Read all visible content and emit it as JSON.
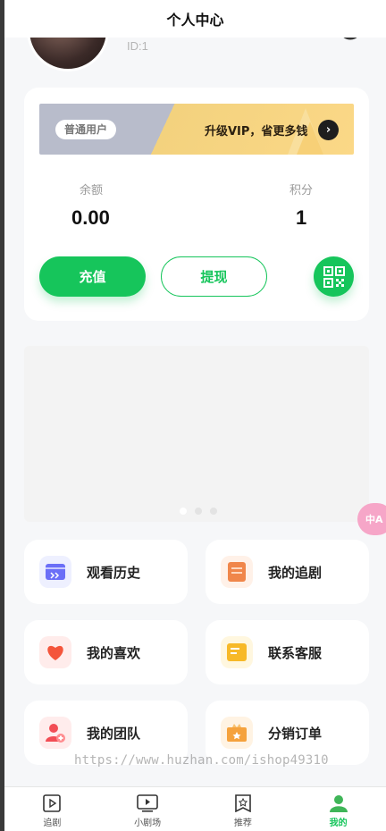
{
  "header": {
    "title": "个人中心"
  },
  "profile": {
    "user_id": "ID:1"
  },
  "card": {
    "vip_tag": "普通用户",
    "vip_text": "升级VIP，省更多钱",
    "vip_arrow": "›",
    "balance_label": "余额",
    "balance_value": "0.00",
    "points_label": "积分",
    "points_value": "1",
    "recharge_label": "充值",
    "withdraw_label": "提现"
  },
  "translate_fab": "中A",
  "menu": [
    {
      "label": "观看历史",
      "icon": "history-icon",
      "color": "#6b6ff7"
    },
    {
      "label": "我的追剧",
      "icon": "follow-drama-icon",
      "color": "#f0864a"
    },
    {
      "label": "我的喜欢",
      "icon": "heart-icon",
      "color": "#f4553b"
    },
    {
      "label": "联系客服",
      "icon": "customer-service-icon",
      "color": "#f7b928"
    },
    {
      "label": "我的团队",
      "icon": "team-icon",
      "color": "#f24d55"
    },
    {
      "label": "分销订单",
      "icon": "order-icon",
      "color": "#f5a23d"
    }
  ],
  "watermark": "https://www.huzhan.com/ishop49310",
  "tabbar": [
    {
      "label": "追剧",
      "icon": "play-square-icon"
    },
    {
      "label": "小剧场",
      "icon": "tv-play-icon"
    },
    {
      "label": "推荐",
      "icon": "star-bookmark-icon"
    },
    {
      "label": "我的",
      "icon": "user-icon"
    }
  ],
  "colors": {
    "accent": "#16c55b",
    "vip_gold": "#fbd887",
    "vip_gray": "#b8bccb"
  }
}
